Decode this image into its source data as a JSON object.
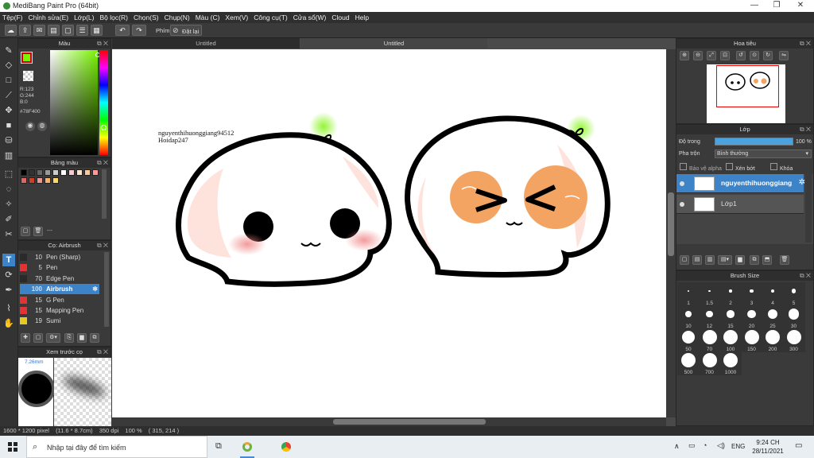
{
  "window": {
    "title": "MediBang Paint Pro (64bit)",
    "minimize": "—",
    "maximize": "❐",
    "close": "✕"
  },
  "menu": [
    "Tệp(F)",
    "Chỉnh sửa(E)",
    "Lớp(L)",
    "Bộ lọc(R)",
    "Chọn(S)",
    "Chụp(N)",
    "Màu (C)",
    "Xem(V)",
    "Công cụ(T)",
    "Cửa sổ(W)",
    "Cloud",
    "Help"
  ],
  "toolbar": {
    "shortcut_label": "Phím",
    "reset_label": "Đặt lại"
  },
  "color_panel": {
    "title": "Màu",
    "r": "R:123",
    "g": "G:244",
    "b": "B:0",
    "hex": "#78F400",
    "primary": "#78f400",
    "secondary": "#ffffff"
  },
  "swatch_panel": {
    "title": "Bảng màu",
    "label": "---",
    "colors": [
      "#000000",
      "#333333",
      "#666666",
      "#999999",
      "#cccccc",
      "#ffffff",
      "#f4cccc",
      "#fce5cd",
      "#f9cb9c",
      "#ff9999",
      "#e06666",
      "#cc4125",
      "#ea9999",
      "#f6b26b",
      "#ffd966"
    ]
  },
  "brush_panel": {
    "title": "Cọ: Airbrush",
    "items": [
      {
        "size": "10",
        "name": "Pen (Sharp)",
        "color": "#2a2a2a"
      },
      {
        "size": "5",
        "name": "Pen",
        "color": "#e53333"
      },
      {
        "size": "70",
        "name": "Edge Pen",
        "color": "#2a2a2a"
      },
      {
        "size": "100",
        "name": "Airbrush",
        "color": "#3d83c8"
      },
      {
        "size": "15",
        "name": "G Pen",
        "color": "#e53333"
      },
      {
        "size": "15",
        "name": "Mapping Pen",
        "color": "#e53333"
      },
      {
        "size": "19",
        "name": "Sumi",
        "color": "#e8c920"
      }
    ]
  },
  "preview_panel": {
    "title": "Xem trước cọ",
    "size": "7.26mm"
  },
  "tabs": [
    "Untitled",
    "Untitled"
  ],
  "canvas": {
    "watermark_line1": "nguyenthihuonggiang94512",
    "watermark_line2": "Hoidap247"
  },
  "navigator": {
    "title": "Hoa tiêu"
  },
  "layer_panel": {
    "title": "Lớp",
    "opacity_label": "Độ trong",
    "opacity_value": "100 %",
    "blend_label": "Pha trộn",
    "blend_value": "Bình thường",
    "protect_alpha": "Bảo vệ alpha",
    "clipping": "Xén bớt",
    "lock": "Khóa",
    "layers": [
      {
        "name": "nguyenthihuonggiang"
      },
      {
        "name": "Lớp1"
      }
    ]
  },
  "brush_size_panel": {
    "title": "Brush Size",
    "sizes": [
      "1",
      "1.5",
      "2",
      "3",
      "4",
      "5",
      "10",
      "12",
      "15",
      "20",
      "25",
      "30",
      "50",
      "70",
      "100",
      "150",
      "200",
      "300",
      "500",
      "700",
      "1000"
    ]
  },
  "status": {
    "dimensions": "1600 * 1200 pixel",
    "physical": "(11.6 * 8.7cm)",
    "dpi": "350 dpi",
    "zoom": "100 %",
    "coords": "( 315, 214 )"
  },
  "taskbar": {
    "search_placeholder": "Nhập tại đây để tìm kiếm",
    "lang": "ENG",
    "time": "9:24 CH",
    "date": "28/11/2021"
  }
}
